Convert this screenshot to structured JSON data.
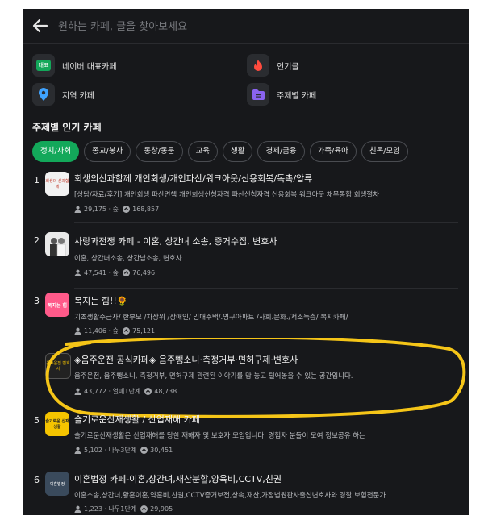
{
  "search": {
    "placeholder": "원하는 카페, 글을 찾아보세요"
  },
  "shortcuts": [
    {
      "label": "네이버 대표카페",
      "icon": "naver-rep-cafe-icon",
      "badge": "대표"
    },
    {
      "label": "인기글",
      "icon": "fire-icon"
    },
    {
      "label": "지역 카페",
      "icon": "location-pin-icon"
    },
    {
      "label": "주제별 카페",
      "icon": "folder-icon"
    }
  ],
  "section_title": "주제별 인기 카페",
  "categories": [
    "정치/사회",
    "종교/봉사",
    "동창/동문",
    "교육",
    "생활",
    "경제/금융",
    "가족/육아",
    "친목/모임"
  ],
  "active_category": "정치/사회",
  "cafes": [
    {
      "rank": "1",
      "title": "회생의신과함께 개인회생/개인파산/워크아웃/신용회복/독촉/압류",
      "desc": "[상담/자료/후기] 개인회생 파산면책 개인회생신청자격 파산신청자격 신용회복 워크아웃 채무통합 회생절차",
      "members": "29,175",
      "level": "숲",
      "visits": "168,857",
      "thumb_text": "회생의 신과함께",
      "thumb_color": "#f2f2f2"
    },
    {
      "rank": "2",
      "title": "사랑과전쟁 카페 - 이혼, 상간녀 소송, 증거수집, 변호사",
      "desc": "이혼, 상간녀소송, 상간남소송, 변호사",
      "members": "47,541",
      "level": "숲",
      "visits": "76,496",
      "thumb_text": "",
      "thumb_color": "#e9e9e9"
    },
    {
      "rank": "3",
      "title": "복지는 힘!!🌻",
      "desc": "기초생활수급자/ 한부모 /차상위 /장애인/ 임대주택/.영구아파트 /사회.문화./저소득층/ 복지카페/",
      "members": "11,406",
      "level": "숲",
      "visits": "75,121",
      "thumb_text": "복지는 힘",
      "thumb_color": "#ff5a8a"
    },
    {
      "rank": "",
      "title": "◈음주운전 공식카페◈ 음주뺑소니·측정거부·면허구제·변호사",
      "desc": "음주운전, 음주뺑소니, 측정거부, 면허구제 관련된 이야기를 맘 놓고 털어놓을 수 있는 공간입니다.",
      "members": "43,772",
      "level": "열매1단계",
      "visits": "48,738",
      "thumb_text": "음주운전 변호사",
      "thumb_color": "#222222"
    },
    {
      "rank": "5",
      "title": "슬기로운산재생활 / 산업재해 카페",
      "desc": "슬기로운산재생활은 산업재해를 당한 재해자 및 보호자 모임입니다. 경험자 분들이 모여 정보공유 하는",
      "members": "5,102",
      "level": "나무3단계",
      "visits": "30,451",
      "thumb_text": "슬기로운 산재생활",
      "thumb_color": "#f5c400"
    },
    {
      "rank": "6",
      "title": "이혼법정 카페-이혼,상간녀,재산분할,양육비,CCTV,친권",
      "desc": "이혼소송,상간녀,황혼이혼,약혼비,친권,CCTV증거보전,상속,재산,가정법원판사출신변호사와 경찰,보험전문가",
      "members": "1,223",
      "level": "나무1단계",
      "visits": "29,905",
      "thumb_text": "이혼법정",
      "thumb_color": "#3a4a5c"
    }
  ],
  "colors": {
    "background": "#17181b",
    "accent": "#13a85a",
    "highlight": "#f5c518",
    "text": "#e6e6e6"
  }
}
